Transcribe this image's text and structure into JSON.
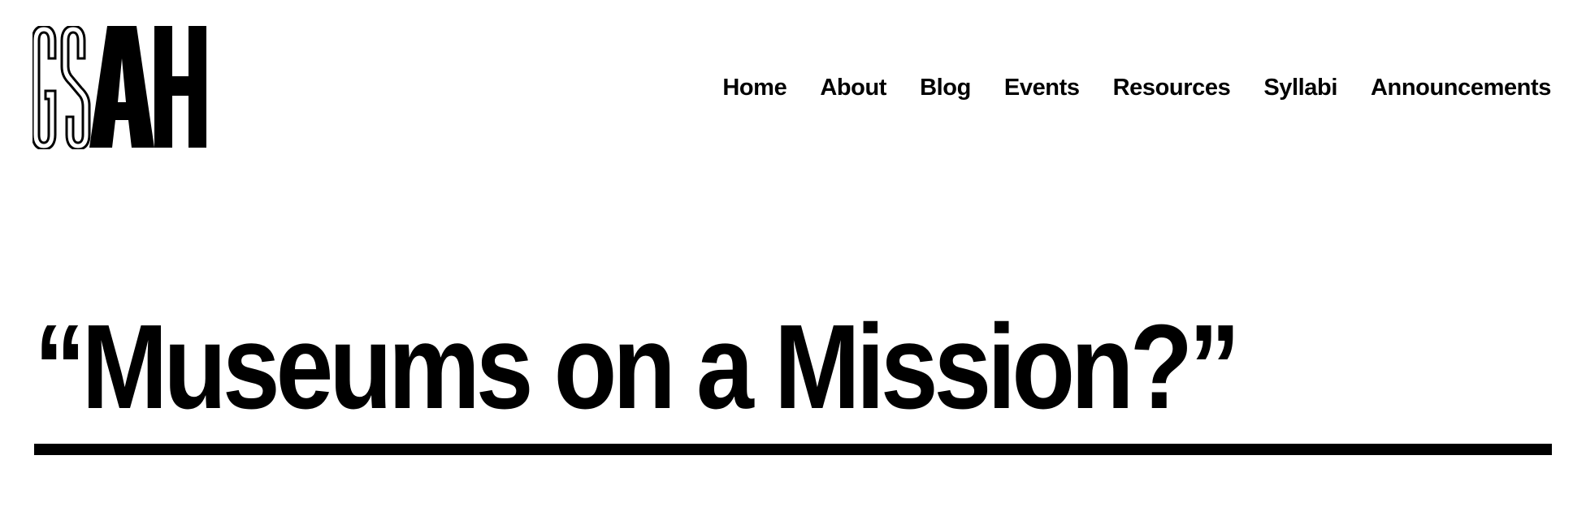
{
  "site": {
    "logo_text": "GSAH",
    "logo_icon": "gsah-wordmark-logo"
  },
  "nav": {
    "items": [
      {
        "label": "Home"
      },
      {
        "label": "About"
      },
      {
        "label": "Blog"
      },
      {
        "label": "Events"
      },
      {
        "label": "Resources"
      },
      {
        "label": "Syllabi"
      },
      {
        "label": "Announcements"
      }
    ]
  },
  "main": {
    "title": "“Museums on a Mission?”"
  },
  "colors": {
    "background": "#ffffff",
    "text": "#000000",
    "rule": "#000000"
  }
}
